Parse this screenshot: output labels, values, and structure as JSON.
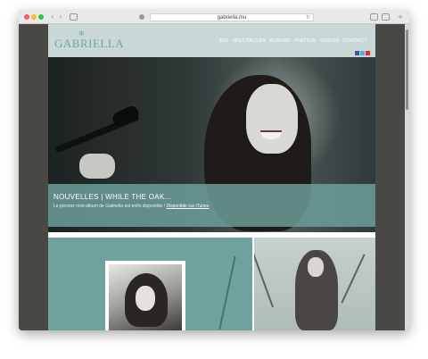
{
  "browser": {
    "url": "gabriella.mu"
  },
  "site": {
    "logo": "GABRIELLA",
    "nav": [
      "BIO",
      "SPECTACLES",
      "ALBUMS",
      "PHOTOS",
      "VIDEOS",
      "CONTACT"
    ],
    "social_icons": [
      "facebook-icon",
      "twitter-icon",
      "youtube-icon"
    ],
    "colors": {
      "accent": "#6fa29c",
      "header_bg": "#c9d8d6",
      "logo": "#6fa7a1"
    }
  },
  "hero": {
    "caption_title": "NOUVELLES  |  WHILE THE OAK...",
    "caption_text": "Le premier mini-album de Gabriella est enfin disponible ! ",
    "caption_link": "Disponible sur iTunes"
  }
}
